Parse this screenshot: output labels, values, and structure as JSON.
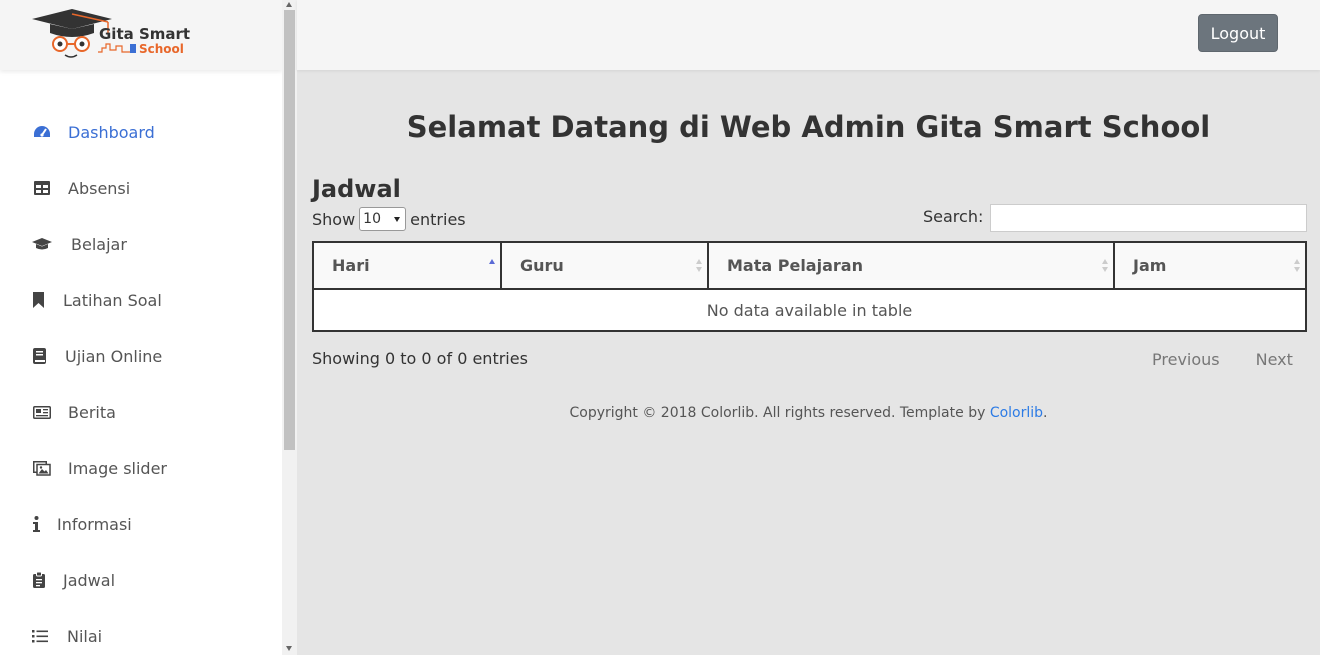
{
  "brand": {
    "line1": "Gita Smart",
    "line2": "School"
  },
  "sidebar": {
    "items": [
      {
        "label": "Dashboard",
        "icon": "dashboard-icon",
        "active": true
      },
      {
        "label": "Absensi",
        "icon": "table-icon"
      },
      {
        "label": "Belajar",
        "icon": "graduation-cap-icon"
      },
      {
        "label": "Latihan Soal",
        "icon": "bookmark-icon"
      },
      {
        "label": "Ujian Online",
        "icon": "book-icon"
      },
      {
        "label": "Berita",
        "icon": "newspaper-icon"
      },
      {
        "label": "Image slider",
        "icon": "images-icon"
      },
      {
        "label": "Informasi",
        "icon": "info-icon"
      },
      {
        "label": "Jadwal",
        "icon": "clipboard-icon"
      },
      {
        "label": "Nilai",
        "icon": "list-icon"
      }
    ]
  },
  "topbar": {
    "logout_label": "Logout"
  },
  "main": {
    "title": "Selamat Datang di Web Admin Gita Smart School",
    "section_title": "Jadwal",
    "length": {
      "show": "Show",
      "value": "10",
      "entries": "entries"
    },
    "search": {
      "label": "Search:",
      "value": ""
    },
    "table": {
      "columns": [
        "Hari",
        "Guru",
        "Mata Pelajaran",
        "Jam"
      ],
      "empty_message": "No data available in table"
    },
    "info": "Showing 0 to 0 of 0 entries",
    "pager": {
      "previous": "Previous",
      "next": "Next"
    },
    "footer": {
      "text": "Copyright © 2018 Colorlib. All rights reserved. Template by ",
      "link": "Colorlib",
      "suffix": "."
    }
  },
  "colors": {
    "accent": "#3b6fd4",
    "logout_bg": "#6c757d",
    "link": "#2c7be5",
    "logo_orange": "#e8672a"
  }
}
